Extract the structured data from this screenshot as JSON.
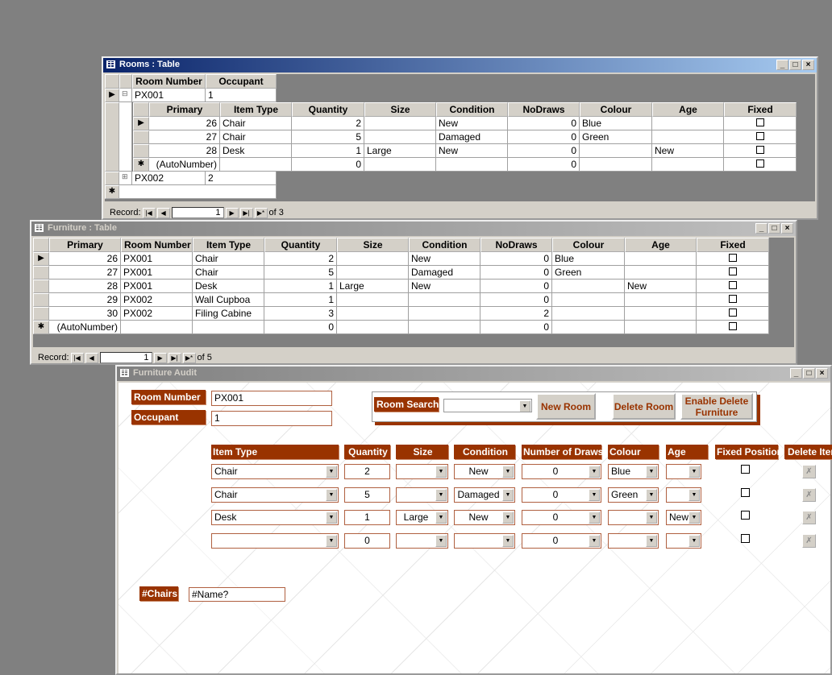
{
  "rooms_window": {
    "title": "Rooms : Table",
    "columns": [
      "Room Number",
      "Occupant"
    ],
    "rows": [
      {
        "room": "PX001",
        "occupant": "1",
        "expanded": true
      },
      {
        "room": "PX002",
        "occupant": "2",
        "expanded": false
      }
    ],
    "sub_columns": [
      "Primary",
      "Item Type",
      "Quantity",
      "Size",
      "Condition",
      "NoDraws",
      "Colour",
      "Age",
      "Fixed"
    ],
    "sub_rows": [
      [
        "26",
        "Chair",
        "2",
        "",
        "New",
        "0",
        "Blue",
        "",
        false
      ],
      [
        "27",
        "Chair",
        "5",
        "",
        "Damaged",
        "0",
        "Green",
        "",
        false
      ],
      [
        "28",
        "Desk",
        "1",
        "Large",
        "New",
        "0",
        "",
        "New",
        false
      ],
      [
        "(AutoNumber)",
        "",
        "0",
        "",
        "",
        "0",
        "",
        "",
        false
      ]
    ],
    "record_label": "Record:",
    "record_value": "1",
    "record_of": "of 3"
  },
  "furniture_window": {
    "title": "Furniture : Table",
    "columns": [
      "Primary",
      "Room Number",
      "Item Type",
      "Quantity",
      "Size",
      "Condition",
      "NoDraws",
      "Colour",
      "Age",
      "Fixed"
    ],
    "rows": [
      [
        "26",
        "PX001",
        "Chair",
        "2",
        "",
        "New",
        "0",
        "Blue",
        "",
        false
      ],
      [
        "27",
        "PX001",
        "Chair",
        "5",
        "",
        "Damaged",
        "0",
        "Green",
        "",
        false
      ],
      [
        "28",
        "PX001",
        "Desk",
        "1",
        "Large",
        "New",
        "0",
        "",
        "New",
        false
      ],
      [
        "29",
        "PX002",
        "Wall Cupboa",
        "1",
        "",
        "",
        "0",
        "",
        "",
        false
      ],
      [
        "30",
        "PX002",
        "Filing Cabine",
        "3",
        "",
        "",
        "2",
        "",
        "",
        false
      ],
      [
        "(AutoNumber)",
        "",
        "",
        "0",
        "",
        "",
        "0",
        "",
        "",
        false
      ]
    ],
    "record_label": "Record:",
    "record_value": "1",
    "record_of": "of 5"
  },
  "audit_form": {
    "title": "Furniture Audit",
    "room_number_label": "Room Number",
    "room_number_value": "PX001",
    "occupant_label": "Occupant",
    "occupant_value": "1",
    "room_search_label": "Room Search",
    "room_search_value": "",
    "new_room": "New Room",
    "delete_room": "Delete Room",
    "enable_delete_furniture": "Enable Delete Furniture",
    "columns": [
      "Item Type",
      "Quantity",
      "Size",
      "Condition",
      "Number of Draws",
      "Colour",
      "Age",
      "Fixed Position",
      "Delete Item"
    ],
    "rows": [
      [
        "Chair",
        "2",
        "",
        "New",
        "0",
        "Blue",
        "",
        false
      ],
      [
        "Chair",
        "5",
        "",
        "Damaged",
        "0",
        "Green",
        "",
        false
      ],
      [
        "Desk",
        "1",
        "Large",
        "New",
        "0",
        "",
        "New",
        false
      ],
      [
        "",
        "0",
        "",
        "",
        "0",
        "",
        "",
        false
      ]
    ],
    "chairs_label": "#Chairs",
    "chairs_value": "#Name?"
  },
  "colors": {
    "accent": "#993300",
    "titlebar": "#0a246a"
  }
}
